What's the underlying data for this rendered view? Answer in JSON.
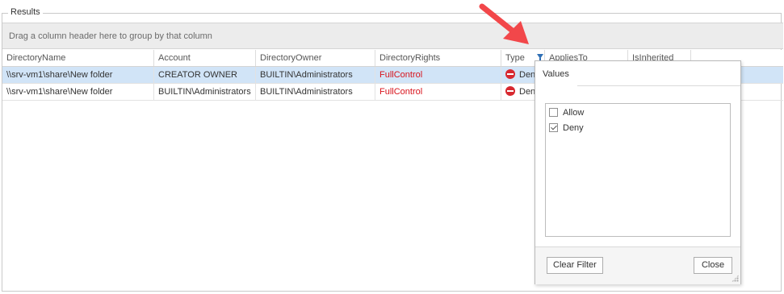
{
  "results_group": {
    "title": "Results"
  },
  "group_panel": {
    "hint": "Drag a column header here to group by that column"
  },
  "columns": [
    {
      "label": "DirectoryName"
    },
    {
      "label": "Account"
    },
    {
      "label": "DirectoryOwner"
    },
    {
      "label": "DirectoryRights"
    },
    {
      "label": "Type"
    },
    {
      "label": "AppliesTo"
    },
    {
      "label": "IsInherited"
    }
  ],
  "rows": [
    {
      "directory_name": "\\\\srv-vm1\\share\\New folder",
      "account": "CREATOR OWNER",
      "directory_owner": "BUILTIN\\Administrators",
      "directory_rights": "FullControl",
      "type": "Deny",
      "selected": true
    },
    {
      "directory_name": "\\\\srv-vm1\\share\\New folder",
      "account": "BUILTIN\\Administrators",
      "directory_owner": "BUILTIN\\Administrators",
      "directory_rights": "FullControl",
      "type": "Deny",
      "selected": false
    }
  ],
  "filter_popup": {
    "tab_label": "Values",
    "options": [
      {
        "label": "Allow",
        "checked": false
      },
      {
        "label": "Deny",
        "checked": true
      }
    ],
    "clear_filter_label": "Clear Filter",
    "close_label": "Close"
  },
  "colors": {
    "selected_row": "#d1e4f7",
    "rights_text": "#d8121b",
    "deny_icon": "#d7282f",
    "filter_icon": "#2f6fb5",
    "annotation_arrow": "#f2474a"
  },
  "icons": {
    "type_deny": "deny-icon",
    "column_filter": "filter-icon",
    "popup_resize": "resize-grip-icon",
    "annotation": "red-arrow-icon"
  }
}
